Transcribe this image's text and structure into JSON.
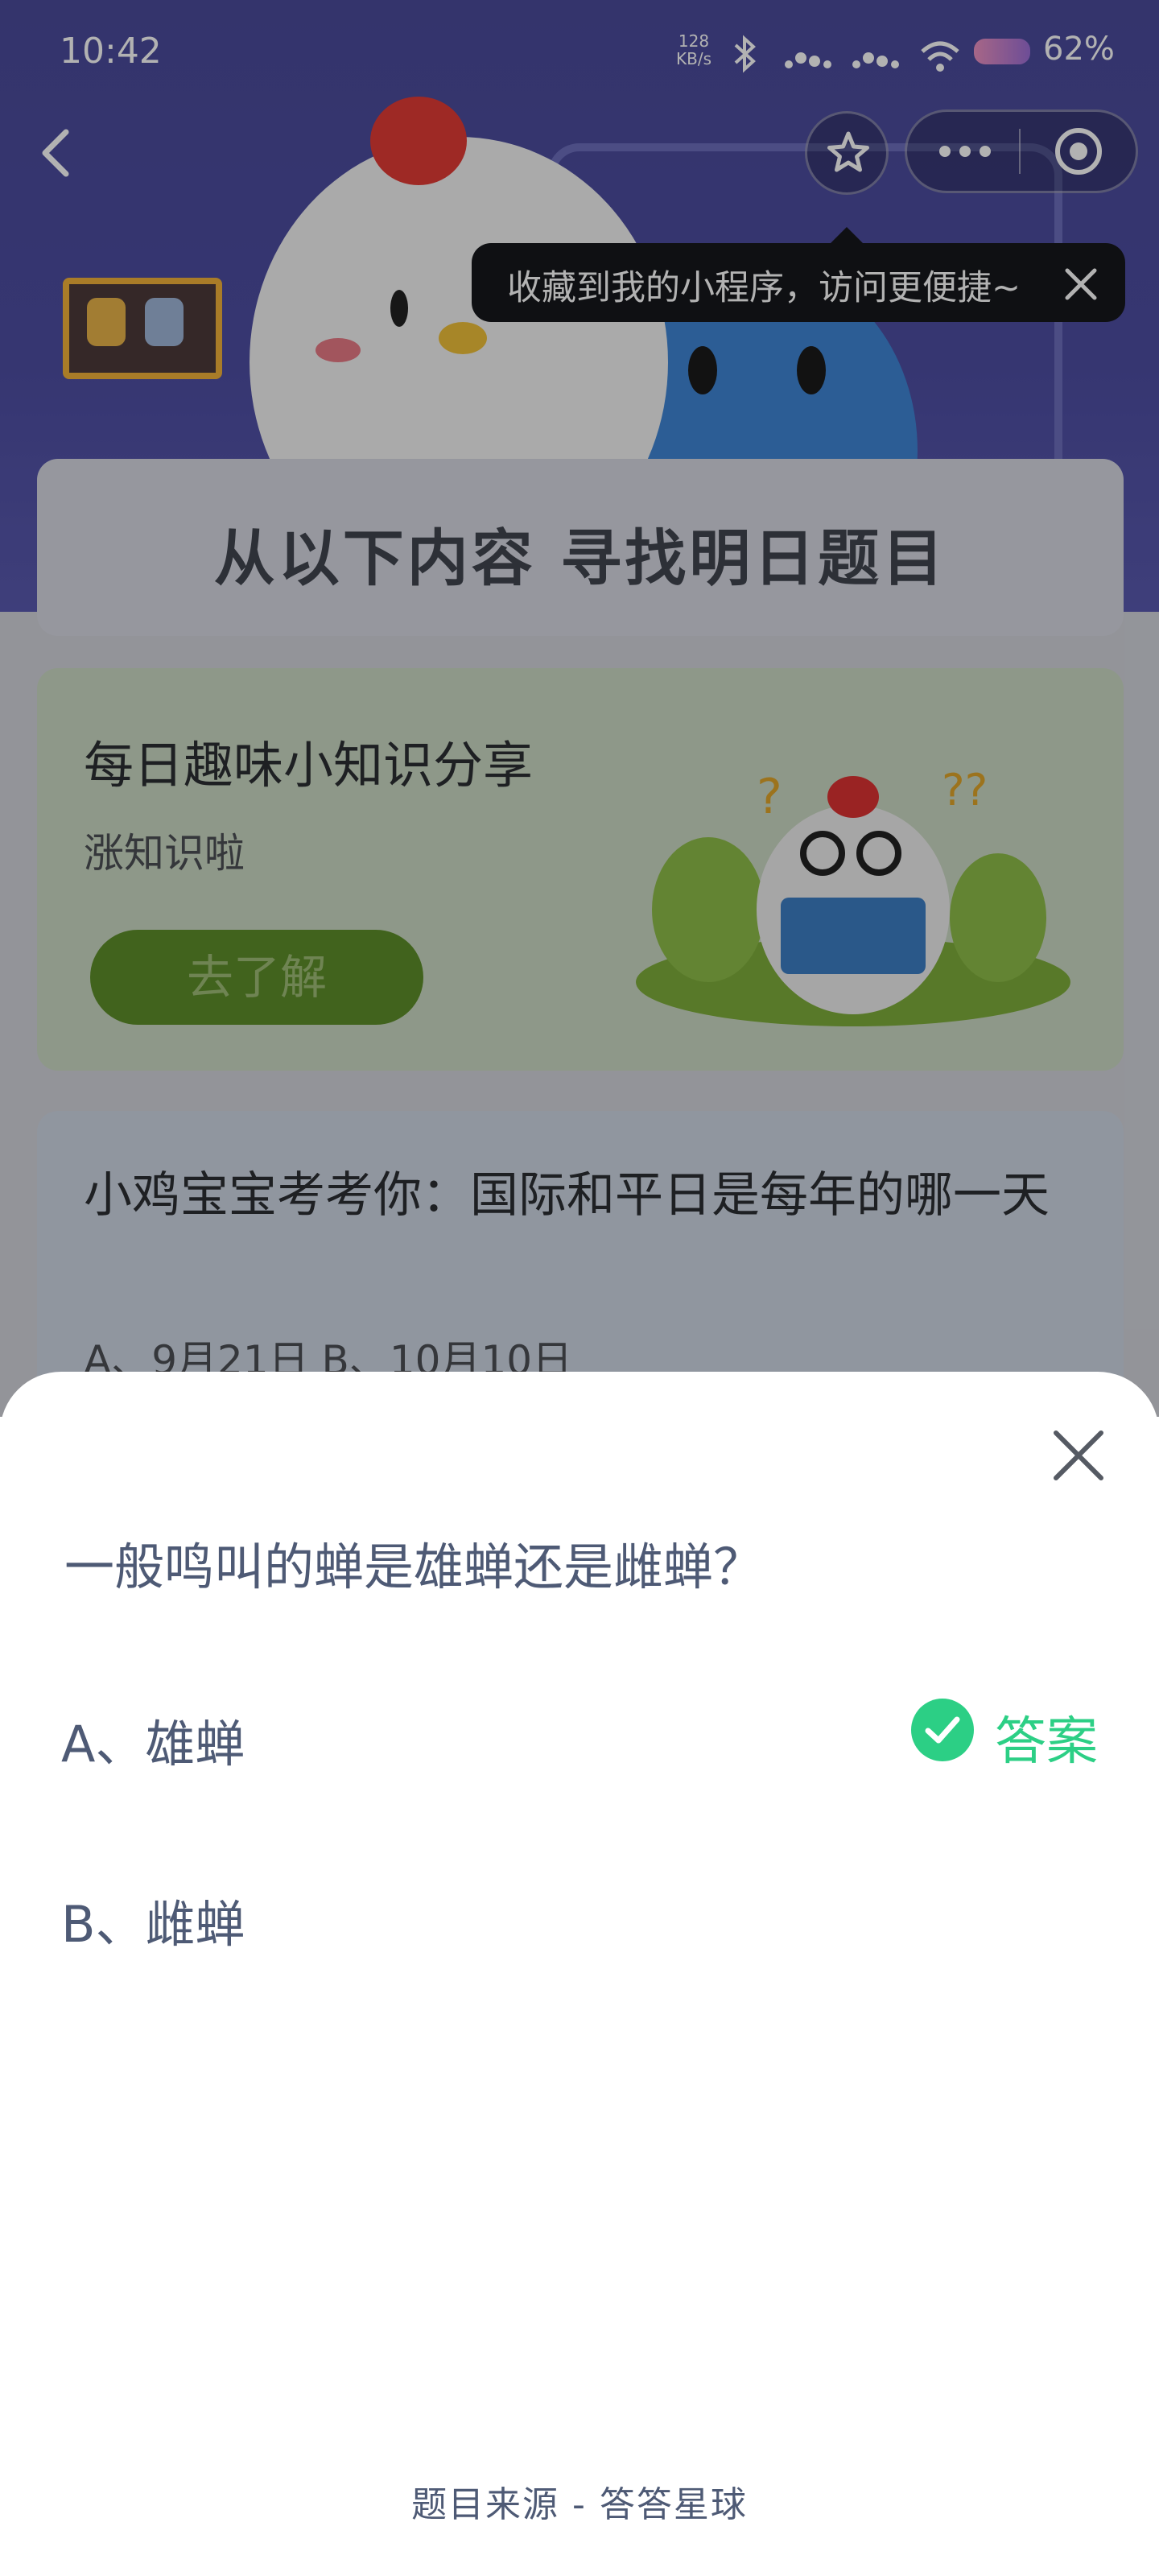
{
  "status_bar": {
    "time": "10:42",
    "net_speed_value": "128",
    "net_speed_unit": "KB/s",
    "battery": "62%"
  },
  "nav": {
    "back_icon": "chevron-left-icon",
    "favorite_icon": "star-icon",
    "more_icon": "more-dots-icon",
    "target_icon": "target-icon"
  },
  "tooltip": {
    "text": "收藏到我的小程序，访问更便捷~"
  },
  "background": {
    "heading": "从以下内容  寻找明日题目",
    "card_knowledge": {
      "title": "每日趣味小知识分享",
      "subtitle": "涨知识啦",
      "button": "去了解"
    },
    "card_quiz": {
      "question": "小鸡宝宝考考你：国际和平日是每年的哪一天",
      "options": "A、9月21日     B、10月10日"
    }
  },
  "sheet": {
    "question": "一般鸣叫的蝉是雄蝉还是雌蝉？",
    "options": [
      {
        "label": "A、雄蝉",
        "is_answer": true
      },
      {
        "label": "B、雌蝉",
        "is_answer": false
      }
    ],
    "answer_label": "答案",
    "source": "题目来源 - 答答星球"
  },
  "colors": {
    "accent_green": "#2ccf85",
    "text_primary": "#4e5a75",
    "hero_purple": "#4b4b9b"
  }
}
